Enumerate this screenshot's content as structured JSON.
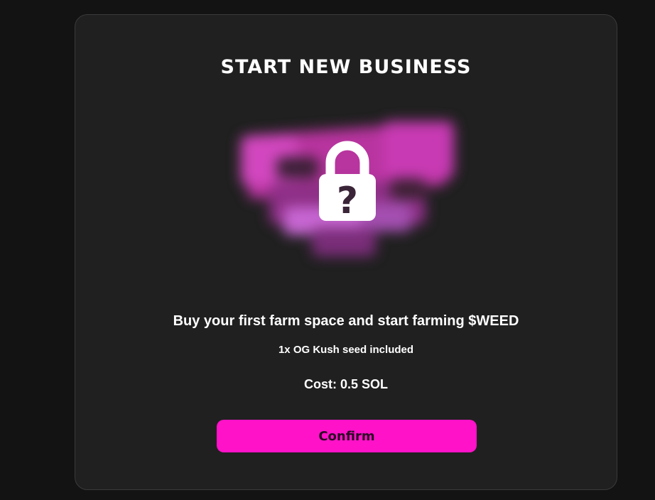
{
  "modal": {
    "title": "START NEW BUSINESS",
    "preview": {
      "image_icon": "blurred-farm-preview",
      "lock_icon": "lock-question-icon",
      "lock_symbol": "?"
    },
    "description": "Buy your first farm space and start farming $WEED",
    "seed_info": "1x OG Kush seed included",
    "cost": "Cost: 0.5 SOL",
    "confirm_label": "Confirm"
  },
  "colors": {
    "background": "#131313",
    "modal_background": "#202020",
    "accent": "#ff12c8",
    "preview_pink": "#c13ab0",
    "lock": "#ffffff",
    "lock_symbol": "#3a2438"
  }
}
